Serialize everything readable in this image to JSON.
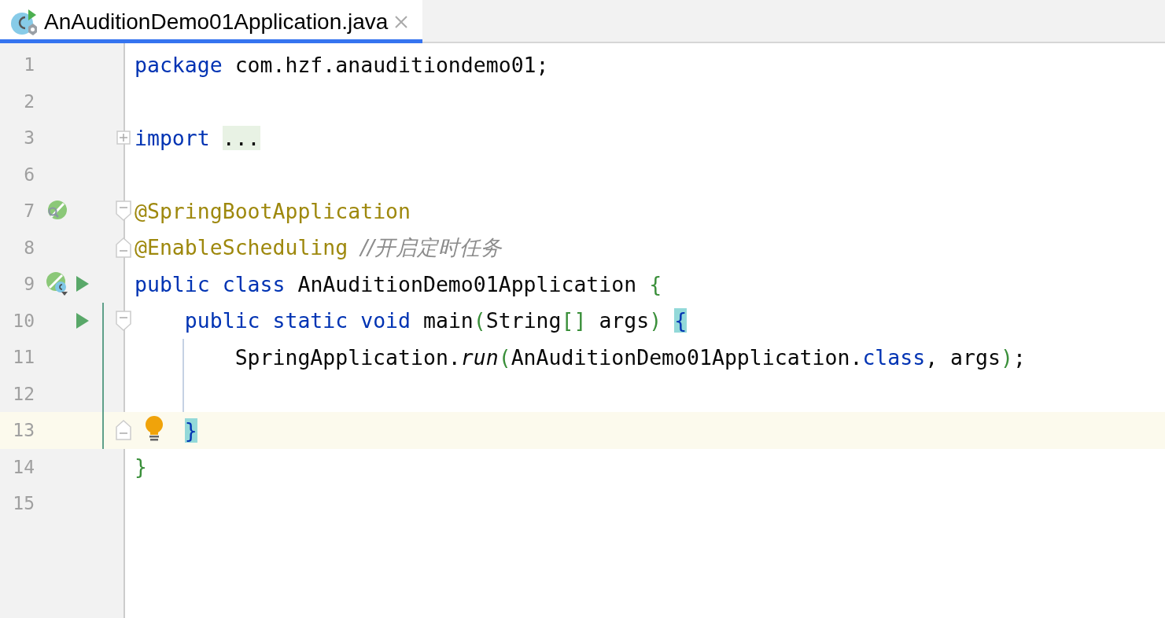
{
  "tab": {
    "title": "AnAuditionDemo01Application.java",
    "selected": true
  },
  "lines": [
    {
      "number": "1",
      "tokens": [
        {
          "text": "package ",
          "kind": "keyword"
        },
        {
          "text": "com.hzf.anauditiondemo01;",
          "kind": "plain"
        }
      ]
    },
    {
      "number": "2"
    },
    {
      "number": "3",
      "fold": {
        "kind": "collapsed"
      },
      "tokens": [
        {
          "text": "import ",
          "kind": "keyword"
        },
        {
          "text": "...",
          "kind": "placeholder"
        }
      ]
    },
    {
      "number": "6"
    },
    {
      "number": "7",
      "fold": {
        "kind": "start"
      },
      "bean": {
        "kind": "search"
      },
      "tokens": [
        {
          "text": "@SpringBootApplication",
          "kind": "annotation"
        }
      ]
    },
    {
      "number": "8",
      "fold": {
        "kind": "end"
      },
      "tokens": [
        {
          "text": "@EnableScheduling ",
          "kind": "annotation"
        },
        {
          "text": "//开启定时任务",
          "kind": "comment"
        }
      ]
    },
    {
      "number": "9",
      "bean": {
        "kind": "class"
      },
      "run": true,
      "tokens": [
        {
          "text": "public ",
          "kind": "keyword"
        },
        {
          "text": "class ",
          "kind": "keyword"
        },
        {
          "text": "AnAuditionDemo01Application ",
          "kind": "plain"
        },
        {
          "text": "{",
          "kind": "bracket"
        }
      ],
      "children": [
        {
          "number": "10",
          "fold": {
            "kind": "start"
          },
          "changed": true,
          "run": true,
          "tokens": [
            {
              "text": "public ",
              "kind": "keyword"
            },
            {
              "text": "static ",
              "kind": "keyword"
            },
            {
              "text": "void ",
              "kind": "keyword"
            },
            {
              "text": "main",
              "kind": "plain"
            },
            {
              "text": "(",
              "kind": "bracket"
            },
            {
              "text": "String",
              "kind": "plain"
            },
            {
              "text": "[]",
              "kind": "bracket"
            },
            {
              "text": " args",
              "kind": "plain"
            },
            {
              "text": ") ",
              "kind": "bracket"
            },
            {
              "text": "{",
              "kind": "match"
            }
          ],
          "children": [
            {
              "number": "11",
              "changed": true,
              "guide": true,
              "tokens": [
                {
                  "text": "SpringApplication.",
                  "kind": "plain"
                },
                {
                  "text": "run",
                  "kind": "method"
                },
                {
                  "text": "(",
                  "kind": "bracket"
                },
                {
                  "text": "AnAuditionDemo01Application.",
                  "kind": "plain"
                },
                {
                  "text": "class",
                  "kind": "keyword"
                },
                {
                  "text": ", args",
                  "kind": "plain"
                },
                {
                  "text": ")",
                  "kind": "bracket"
                },
                {
                  "text": ";",
                  "kind": "plain"
                }
              ]
            },
            {
              "number": "12",
              "changed": true,
              "guide": true
            }
          ]
        },
        {
          "number": "13",
          "fold": {
            "kind": "end"
          },
          "changed": true,
          "current": true,
          "bulb": true,
          "tokens": [
            {
              "text": "}",
              "kind": "match"
            }
          ]
        }
      ]
    },
    {
      "number": "14",
      "tokens": [
        {
          "text": "}",
          "kind": "bracket"
        }
      ]
    },
    {
      "number": "15"
    }
  ]
}
